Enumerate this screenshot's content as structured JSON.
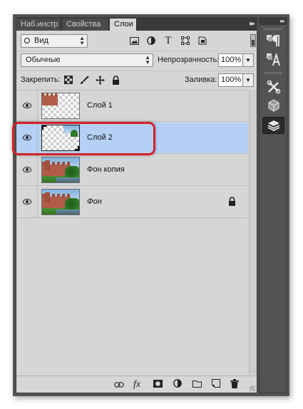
{
  "tabs": [
    {
      "label": "Наб.инстр"
    },
    {
      "label": "Свойства"
    },
    {
      "label": "Слои"
    }
  ],
  "tab_menu_glyph": "▸▸",
  "filter": {
    "kind_label": "Вид",
    "filter_icons": [
      "image-filter-icon",
      "adjustment-filter-icon",
      "type-filter-icon",
      "shape-filter-icon",
      "smart-object-filter-icon"
    ]
  },
  "blend": {
    "mode": "Обычные",
    "opacity_label": "Непрозрачность:",
    "opacity_value": "100%"
  },
  "lock": {
    "label": "Закрепить:",
    "icons": [
      "lock-transparent-pixels-icon",
      "lock-image-pixels-icon",
      "lock-position-icon",
      "lock-all-icon"
    ],
    "fill_label": "Заливка:",
    "fill_value": "100%"
  },
  "layers": [
    {
      "name": "Слой 1",
      "visible": true,
      "selected": false,
      "italic": false,
      "locked": false
    },
    {
      "name": "Слой 2",
      "visible": true,
      "selected": true,
      "italic": false,
      "locked": false
    },
    {
      "name": "Фон копия",
      "visible": true,
      "selected": false,
      "italic": false,
      "locked": false
    },
    {
      "name": "Фон",
      "visible": true,
      "selected": false,
      "italic": true,
      "locked": true
    }
  ],
  "bottom_icons": [
    "link-layers-icon",
    "fx-icon",
    "layer-mask-icon",
    "adjustment-layer-icon",
    "new-group-icon",
    "new-layer-icon",
    "delete-icon"
  ],
  "bottom": {
    "fx_label": "fx"
  },
  "dock_icons": [
    "paragraph-styles-icon",
    "character-styles-icon",
    "tools-icon",
    "3d-icon",
    "layers-panel-icon"
  ],
  "colors": {
    "selected_row": "#b4d0f5",
    "highlight_border": "#d7212a",
    "panel_bg": "#d6d6d6",
    "dock_bg": "#535353"
  }
}
